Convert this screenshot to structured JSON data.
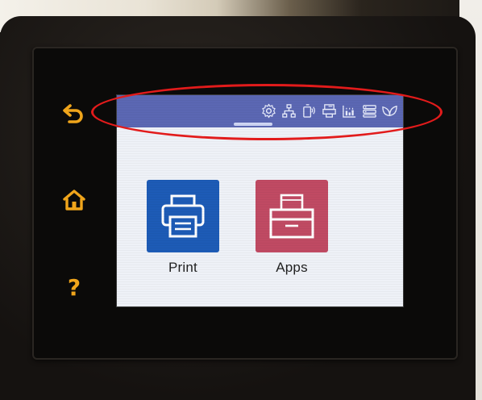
{
  "side_keys": {
    "back_icon": "back-arrow-icon",
    "home_icon": "home-icon",
    "help_label": "?"
  },
  "dashboard": {
    "icons": [
      "settings-icon",
      "network-icon",
      "wifi-direct-icon",
      "web-services-icon",
      "ink-levels-icon",
      "setup-menu-icon",
      "eco-leaf-icon"
    ]
  },
  "home_screen": {
    "tiles": [
      {
        "label": "Print",
        "color": "#1d5bb6",
        "icon": "printer-icon"
      },
      {
        "label": "Apps",
        "color": "#c04a63",
        "icon": "apps-icon"
      }
    ]
  },
  "annotation": {
    "color": "#e21b1b",
    "shape": "ellipse"
  },
  "colors": {
    "accent": "#f0a51b",
    "dashboard_bar": "#5b67b3"
  }
}
